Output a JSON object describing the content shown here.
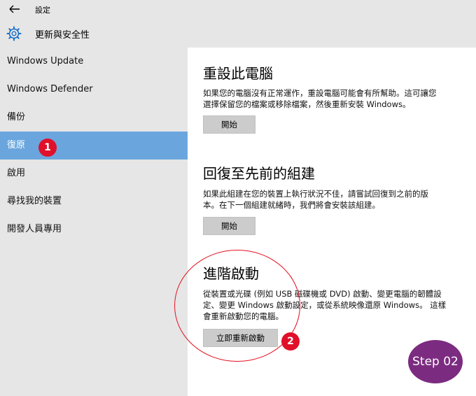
{
  "window": {
    "title": "設定"
  },
  "header": {
    "title": "更新與安全性"
  },
  "sidebar": {
    "items": [
      {
        "label": "Windows Update"
      },
      {
        "label": "Windows Defender"
      },
      {
        "label": "備份"
      },
      {
        "label": "復原",
        "selected": true
      },
      {
        "label": "啟用"
      },
      {
        "label": "尋找我的裝置"
      },
      {
        "label": "開發人員專用"
      }
    ]
  },
  "sections": [
    {
      "title": "重設此電腦",
      "desc_lines": [
        "如果您的電腦沒有正常運作，重設電腦可能會有所幫助。這可讓您",
        "選擇保留您的檔案或移除檔案，然後重新安裝 Windows。"
      ],
      "button": "開始"
    },
    {
      "title": "回復至先前的組建",
      "desc_lines": [
        "如果此組建在您的裝置上執行狀況不佳，請嘗試回復到之前的版",
        "本。在下一個組建就緒時，我們將會安裝該組建。"
      ],
      "button": "開始"
    },
    {
      "title": "進階啟動",
      "desc_lines": [
        "從裝置或光碟 (例如 USB 磁碟機或 DVD) 啟動、變更電腦的韌體設",
        "定、變更 Windows 啟動設定，或從系統映像還原 Windows。 這樣",
        "會重新啟動您的電腦。"
      ],
      "button": "立即重新啟動"
    }
  ],
  "annotations": {
    "badge1": "1",
    "badge2": "2",
    "step": "Step 02"
  },
  "colors": {
    "selected": "#6aa6dd",
    "badge": "#e0102a",
    "step": "#7c2c80",
    "sidebar_bg": "#e6e6e6"
  },
  "icons": {
    "back": "back-arrow-icon",
    "settings": "gear-icon"
  }
}
